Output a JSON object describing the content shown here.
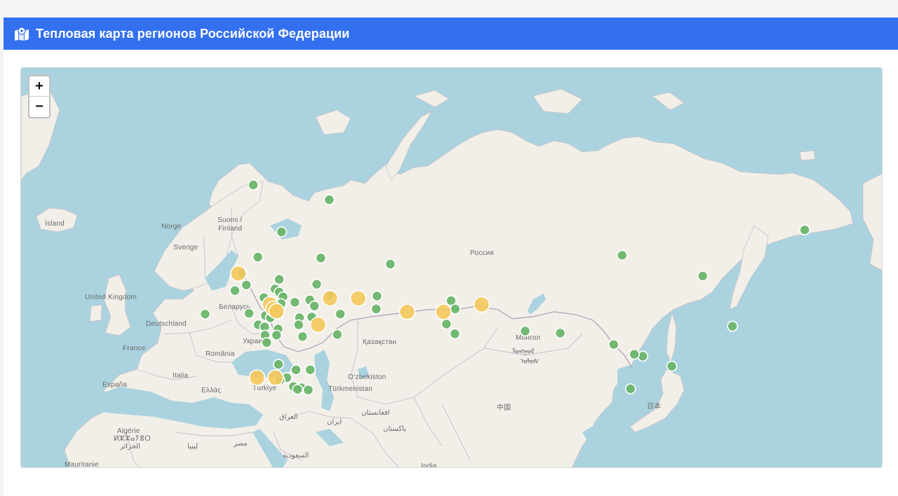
{
  "header": {
    "title": "Тепловая карта регионов Российской Федерации",
    "icon": "map-location-icon"
  },
  "map": {
    "zoom_in_label": "+",
    "zoom_out_label": "−",
    "colors": {
      "water": "#aad3df",
      "land": "#f2efe9",
      "border": "#b7aaba",
      "low": "#6bb56b",
      "high": "#f5c85c"
    },
    "labels": [
      {
        "id": "russia",
        "text": "Россия"
      },
      {
        "id": "iceland",
        "text": "Ísland"
      },
      {
        "id": "norway",
        "text": "Norge"
      },
      {
        "id": "finland1",
        "text": "Suomi /"
      },
      {
        "id": "finland2",
        "text": "Finland"
      },
      {
        "id": "sweden",
        "text": "Sverige"
      },
      {
        "id": "uk",
        "text": "United Kingdom"
      },
      {
        "id": "belarus",
        "text": "Беларусь"
      },
      {
        "id": "germany",
        "text": "Deutschland"
      },
      {
        "id": "ukraine",
        "text": "Украина"
      },
      {
        "id": "france",
        "text": "France"
      },
      {
        "id": "romania",
        "text": "România"
      },
      {
        "id": "kazakhstan",
        "text": "Қазақстан"
      },
      {
        "id": "mongolia1",
        "text": "Монгол"
      },
      {
        "id": "mongolia2",
        "text": "ᠮᠣᠩᠭᠣᠯ"
      },
      {
        "id": "mongolia3",
        "text": "ᠤᠯᠤᠰ"
      },
      {
        "id": "spain",
        "text": "España"
      },
      {
        "id": "italy",
        "text": "Italia"
      },
      {
        "id": "greece",
        "text": "Ελλάς"
      },
      {
        "id": "turkey",
        "text": "Türkiye"
      },
      {
        "id": "uzbekistan",
        "text": "O‘zbekiston"
      },
      {
        "id": "turkmenistan",
        "text": "Türkmenistan"
      },
      {
        "id": "china",
        "text": "中国"
      },
      {
        "id": "japan",
        "text": "日本"
      },
      {
        "id": "iraq",
        "text": "العراق"
      },
      {
        "id": "iran",
        "text": "ایران"
      },
      {
        "id": "afghanistan",
        "text": "افغانستان"
      },
      {
        "id": "pakistan",
        "text": "پاکستان"
      },
      {
        "id": "algeria1",
        "text": "Algérie"
      },
      {
        "id": "algeria2",
        "text": "ⵍⵣⵣⴰⵢⴻⵔ"
      },
      {
        "id": "algeria3",
        "text": "الجزائر"
      },
      {
        "id": "libya",
        "text": "ليبيا"
      },
      {
        "id": "egypt",
        "text": "مصر"
      },
      {
        "id": "saudi",
        "text": "السعودية"
      },
      {
        "id": "mauritania",
        "text": "Mauritanie"
      },
      {
        "id": "india",
        "text": "India"
      }
    ],
    "markers": [
      {
        "lat": 68.9,
        "lon": 33.1,
        "level": "low"
      },
      {
        "lat": 64.5,
        "lon": 40.5,
        "level": "low"
      },
      {
        "lat": 67.6,
        "lon": 53.0,
        "level": "low"
      },
      {
        "lat": 61.8,
        "lon": 34.3,
        "level": "low"
      },
      {
        "lat": 61.7,
        "lon": 50.8,
        "level": "low"
      },
      {
        "lat": 61.0,
        "lon": 69.0,
        "level": "low"
      },
      {
        "lat": 62.0,
        "lon": 129.7,
        "level": "low"
      },
      {
        "lat": 64.7,
        "lon": 177.5,
        "level": "low"
      },
      {
        "lat": 59.6,
        "lon": 150.8,
        "level": "low"
      },
      {
        "lat": 53.0,
        "lon": 158.6,
        "level": "low"
      },
      {
        "lat": 59.9,
        "lon": 30.3,
        "level": "low"
      },
      {
        "lat": 58.5,
        "lon": 31.3,
        "level": "low"
      },
      {
        "lat": 57.8,
        "lon": 28.3,
        "level": "low"
      },
      {
        "lat": 54.7,
        "lon": 20.5,
        "level": "low"
      },
      {
        "lat": 59.2,
        "lon": 39.9,
        "level": "low"
      },
      {
        "lat": 58.0,
        "lon": 38.8,
        "level": "low"
      },
      {
        "lat": 57.6,
        "lon": 39.9,
        "level": "low"
      },
      {
        "lat": 57.0,
        "lon": 40.9,
        "level": "low"
      },
      {
        "lat": 56.9,
        "lon": 35.9,
        "level": "low"
      },
      {
        "lat": 55.8,
        "lon": 37.6,
        "level": "low"
      },
      {
        "lat": 56.1,
        "lon": 40.4,
        "level": "low"
      },
      {
        "lat": 54.6,
        "lon": 39.7,
        "level": "low"
      },
      {
        "lat": 54.5,
        "lon": 36.3,
        "level": "low"
      },
      {
        "lat": 54.2,
        "lon": 37.6,
        "level": "low"
      },
      {
        "lat": 54.8,
        "lon": 32.0,
        "level": "low"
      },
      {
        "lat": 53.2,
        "lon": 34.4,
        "level": "low"
      },
      {
        "lat": 52.9,
        "lon": 36.1,
        "level": "low"
      },
      {
        "lat": 52.6,
        "lon": 39.6,
        "level": "low"
      },
      {
        "lat": 51.7,
        "lon": 36.2,
        "level": "low"
      },
      {
        "lat": 51.7,
        "lon": 39.2,
        "level": "low"
      },
      {
        "lat": 50.6,
        "lon": 36.6,
        "level": "low"
      },
      {
        "lat": 56.3,
        "lon": 44.0,
        "level": "low"
      },
      {
        "lat": 56.6,
        "lon": 47.9,
        "level": "low"
      },
      {
        "lat": 55.8,
        "lon": 49.1,
        "level": "low"
      },
      {
        "lat": 54.2,
        "lon": 45.2,
        "level": "low"
      },
      {
        "lat": 53.2,
        "lon": 45.0,
        "level": "low"
      },
      {
        "lat": 54.3,
        "lon": 48.4,
        "level": "low"
      },
      {
        "lat": 58.6,
        "lon": 49.7,
        "level": "low"
      },
      {
        "lat": 57.2,
        "lon": 53.2,
        "level": "low"
      },
      {
        "lat": 51.5,
        "lon": 46.0,
        "level": "low"
      },
      {
        "lat": 54.7,
        "lon": 55.9,
        "level": "low"
      },
      {
        "lat": 51.8,
        "lon": 55.1,
        "level": "low"
      },
      {
        "lat": 57.1,
        "lon": 65.5,
        "level": "low"
      },
      {
        "lat": 55.4,
        "lon": 65.3,
        "level": "low"
      },
      {
        "lat": 56.5,
        "lon": 84.9,
        "level": "low"
      },
      {
        "lat": 55.4,
        "lon": 86.0,
        "level": "low"
      },
      {
        "lat": 53.3,
        "lon": 83.7,
        "level": "low"
      },
      {
        "lat": 51.9,
        "lon": 85.9,
        "level": "low"
      },
      {
        "lat": 52.3,
        "lon": 104.3,
        "level": "low"
      },
      {
        "lat": 52.0,
        "lon": 113.5,
        "level": "low"
      },
      {
        "lat": 50.3,
        "lon": 127.5,
        "level": "low"
      },
      {
        "lat": 48.5,
        "lon": 135.1,
        "level": "low"
      },
      {
        "lat": 48.8,
        "lon": 132.9,
        "level": "low"
      },
      {
        "lat": 43.1,
        "lon": 131.9,
        "level": "low"
      },
      {
        "lat": 46.9,
        "lon": 142.7,
        "level": "low"
      },
      {
        "lat": 47.2,
        "lon": 39.7,
        "level": "low"
      },
      {
        "lat": 46.3,
        "lon": 48.0,
        "level": "low"
      },
      {
        "lat": 46.3,
        "lon": 44.3,
        "level": "low"
      },
      {
        "lat": 45.0,
        "lon": 41.9,
        "level": "low"
      },
      {
        "lat": 43.5,
        "lon": 43.6,
        "level": "low"
      },
      {
        "lat": 43.3,
        "lon": 45.7,
        "level": "low"
      },
      {
        "lat": 43.0,
        "lon": 44.7,
        "level": "low"
      },
      {
        "lat": 44.6,
        "lon": 40.1,
        "level": "low"
      },
      {
        "lat": 42.9,
        "lon": 47.5,
        "level": "low"
      },
      {
        "lat": 59.9,
        "lon": 29.2,
        "level": "high"
      },
      {
        "lat": 56.0,
        "lon": 37.5,
        "level": "high"
      },
      {
        "lat": 55.4,
        "lon": 38.4,
        "level": "high"
      },
      {
        "lat": 55.1,
        "lon": 39.2,
        "level": "high"
      },
      {
        "lat": 56.8,
        "lon": 53.2,
        "level": "high"
      },
      {
        "lat": 56.8,
        "lon": 60.6,
        "level": "high"
      },
      {
        "lat": 55.0,
        "lon": 73.4,
        "level": "high"
      },
      {
        "lat": 55.0,
        "lon": 82.9,
        "level": "high"
      },
      {
        "lat": 56.0,
        "lon": 92.9,
        "level": "high"
      },
      {
        "lat": 53.2,
        "lon": 50.1,
        "level": "high"
      },
      {
        "lat": 45.0,
        "lon": 34.1,
        "level": "high"
      },
      {
        "lat": 45.0,
        "lon": 38.9,
        "level": "high"
      }
    ]
  }
}
